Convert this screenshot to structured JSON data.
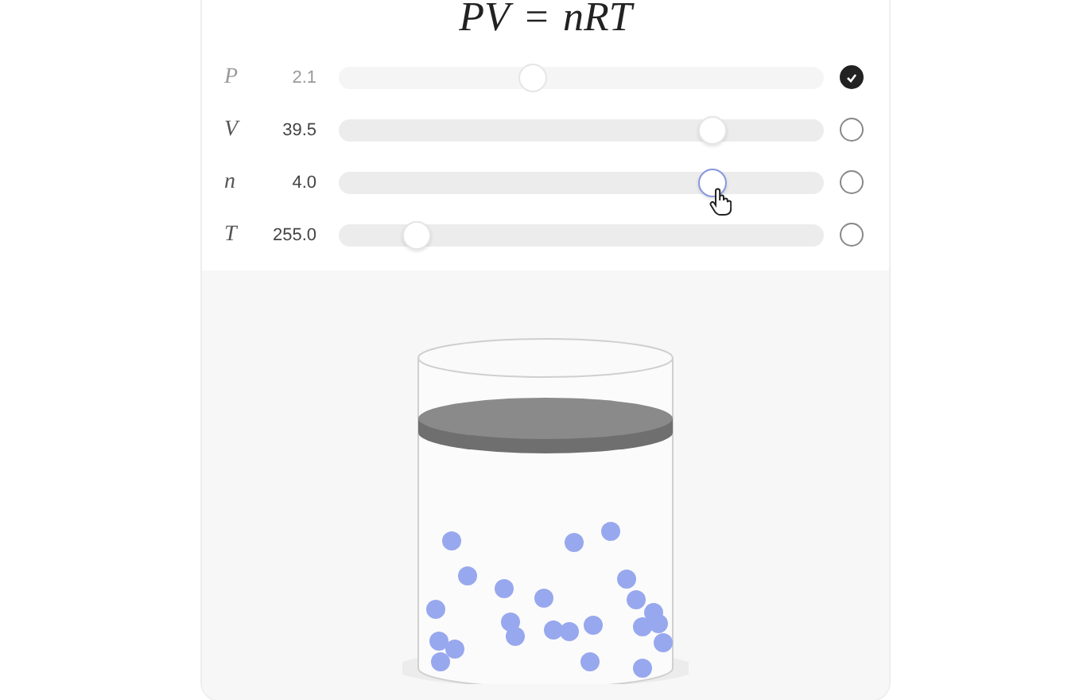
{
  "formula": {
    "left": "PV",
    "equals": "=",
    "right": "nRT"
  },
  "variables": [
    {
      "symbol": "P",
      "value": "2.1",
      "level": 0.4,
      "selected": true,
      "active": false
    },
    {
      "symbol": "V",
      "value": "39.5",
      "level": 0.77,
      "selected": false,
      "active": false
    },
    {
      "symbol": "n",
      "value": "4.0",
      "level": 0.77,
      "selected": false,
      "active": true
    },
    {
      "symbol": "T",
      "value": "255.0",
      "level": 0.16,
      "selected": false,
      "active": false
    }
  ]
}
